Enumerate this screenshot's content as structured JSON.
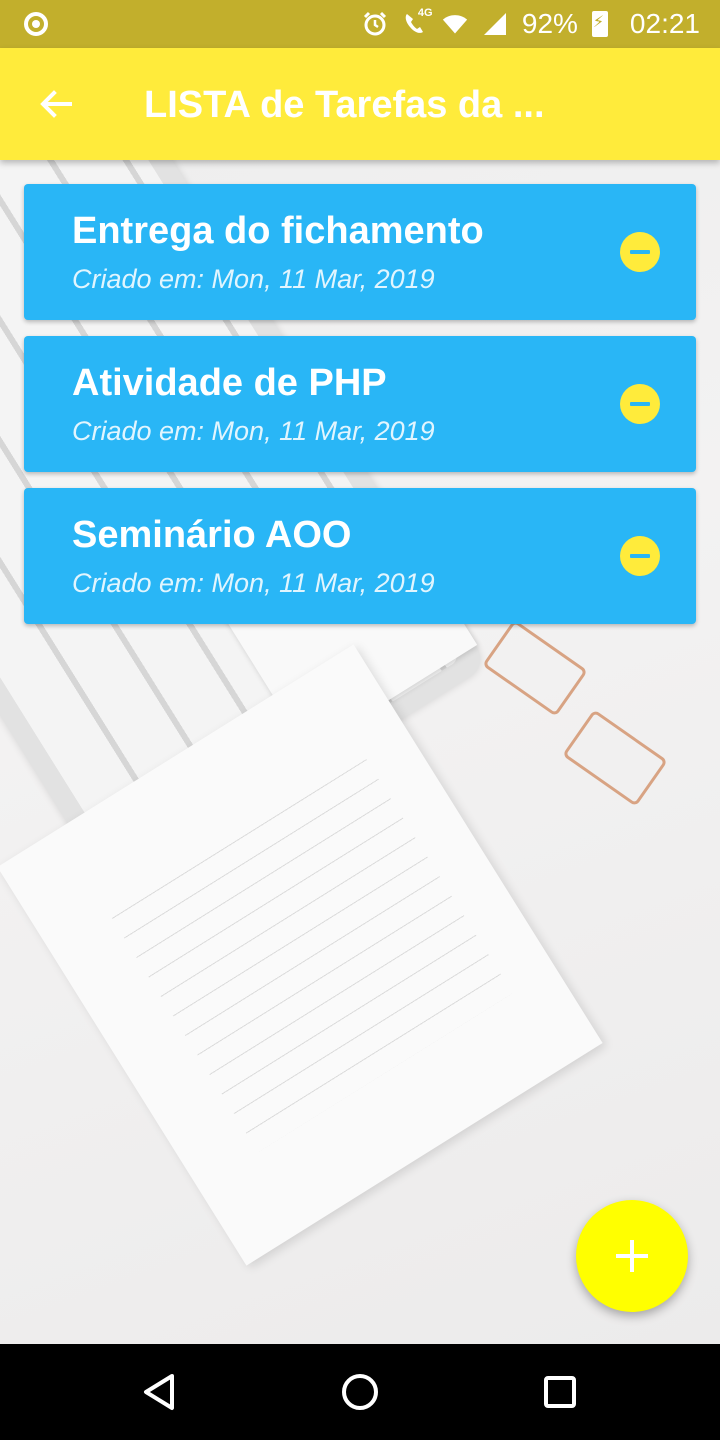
{
  "status_bar": {
    "battery_percent": "92%",
    "time": "02:21",
    "network": "4G",
    "icons": [
      "notification-icon",
      "alarm-icon",
      "call-icon",
      "wifi-icon",
      "signal-icon",
      "battery-charging-icon"
    ]
  },
  "app_bar": {
    "title": "LISTA de Tarefas da ...",
    "back_icon": "arrow-back-icon",
    "background_color": "#ffeb3b"
  },
  "tasks": [
    {
      "title": "Entrega do fichamento",
      "created": "Criado em: Mon, 11 Mar, 2019"
    },
    {
      "title": "Atividade de PHP",
      "created": "Criado em: Mon, 11 Mar, 2019"
    },
    {
      "title": "Seminário AOO",
      "created": "Criado em: Mon, 11 Mar, 2019"
    }
  ],
  "colors": {
    "card": "#29b6f6",
    "remove_button": "#ffeb3b",
    "fab": "#ffff00",
    "status_bar": "#c2af2c"
  },
  "fab": {
    "icon": "plus-icon"
  },
  "nav_bar": {
    "icons": [
      "back-triangle-icon",
      "home-circle-icon",
      "recents-square-icon"
    ]
  }
}
